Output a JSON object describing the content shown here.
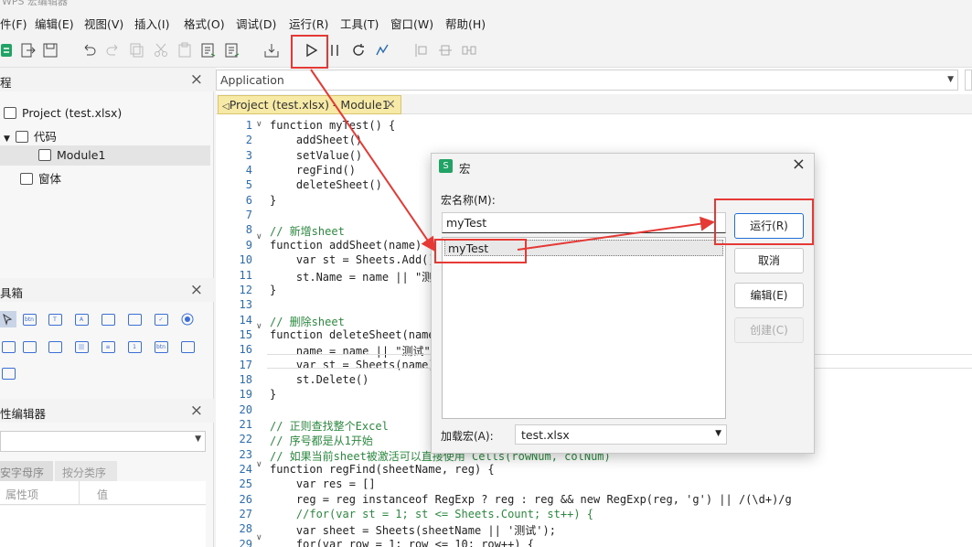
{
  "window": {
    "title": "WPS 宏编辑器"
  },
  "menubar": {
    "items": [
      "件(F)",
      "编辑(E)",
      "视图(V)",
      "插入(I)",
      "格式(O)",
      "调试(D)",
      "运行(R)",
      "工具(T)",
      "窗口(W)",
      "帮助(H)"
    ]
  },
  "project_panel": {
    "title": "程",
    "close": "×",
    "tree": {
      "project": "Project (test.xlsx)",
      "code": "代码",
      "module": "Module1",
      "forms": "窗体"
    }
  },
  "toolbox_panel": {
    "title": "具箱",
    "close": "×"
  },
  "property_panel": {
    "title": "性编辑器",
    "close": "×",
    "tabs": [
      "安字母序",
      "按分类序"
    ],
    "columns": [
      "属性项",
      "值"
    ]
  },
  "editor": {
    "object_dropdown": "Application",
    "tab_label": "Project (test.xlsx) - Module1",
    "tab_close": "×",
    "line_numbers": [
      "1",
      "2",
      "3",
      "4",
      "5",
      "6",
      "7",
      "8",
      "9",
      "10",
      "11",
      "12",
      "13",
      "14",
      "15",
      "16",
      "17",
      "18",
      "19",
      "20",
      "21",
      "22",
      "23",
      "24",
      "25",
      "26",
      "27",
      "28",
      "29"
    ],
    "lines": [
      "function myTest() {",
      "    addSheet()",
      "    setValue()",
      "    regFind()",
      "    deleteSheet()",
      "}",
      "",
      "// 新增sheet",
      "function addSheet(name) {",
      "    var st = Sheets.Add()",
      "    st.Name = name || \"测",
      "}",
      "",
      "// 删除sheet",
      "function deleteSheet(name",
      "    name = name || \"测试\"",
      "    var st = Sheets(name)",
      "    st.Delete()",
      "}",
      "",
      "// 正则查找整个Excel",
      "// 序号都是从1开始",
      "// 如果当前sheet被激活可以直接使用 Cells(rowNum, colNum)",
      "function regFind(sheetName, reg) {",
      "    var res = []",
      "    reg = reg instanceof RegExp ? reg : reg && new RegExp(reg, 'g') || /(\\d+)/g",
      "    //for(var st = 1; st <= Sheets.Count; st++) {",
      "    var sheet = Sheets(sheetName || '测试');",
      "    for(var row = 1; row <= 10; row++) {"
    ]
  },
  "dialog": {
    "title": "宏",
    "close": "×",
    "name_label": "宏名称(M):",
    "name_value": "myTest",
    "list_items": [
      "myTest"
    ],
    "load_label": "加载宏(A):",
    "load_value": "test.xlsx",
    "buttons": {
      "run": "运行(R)",
      "cancel": "取消",
      "edit": "编辑(E)",
      "create": "创建(C)"
    }
  },
  "colors": {
    "annotation": "#e53935",
    "dialog_icon": "#21a366",
    "tab_highlight": "#f7e9a6"
  }
}
